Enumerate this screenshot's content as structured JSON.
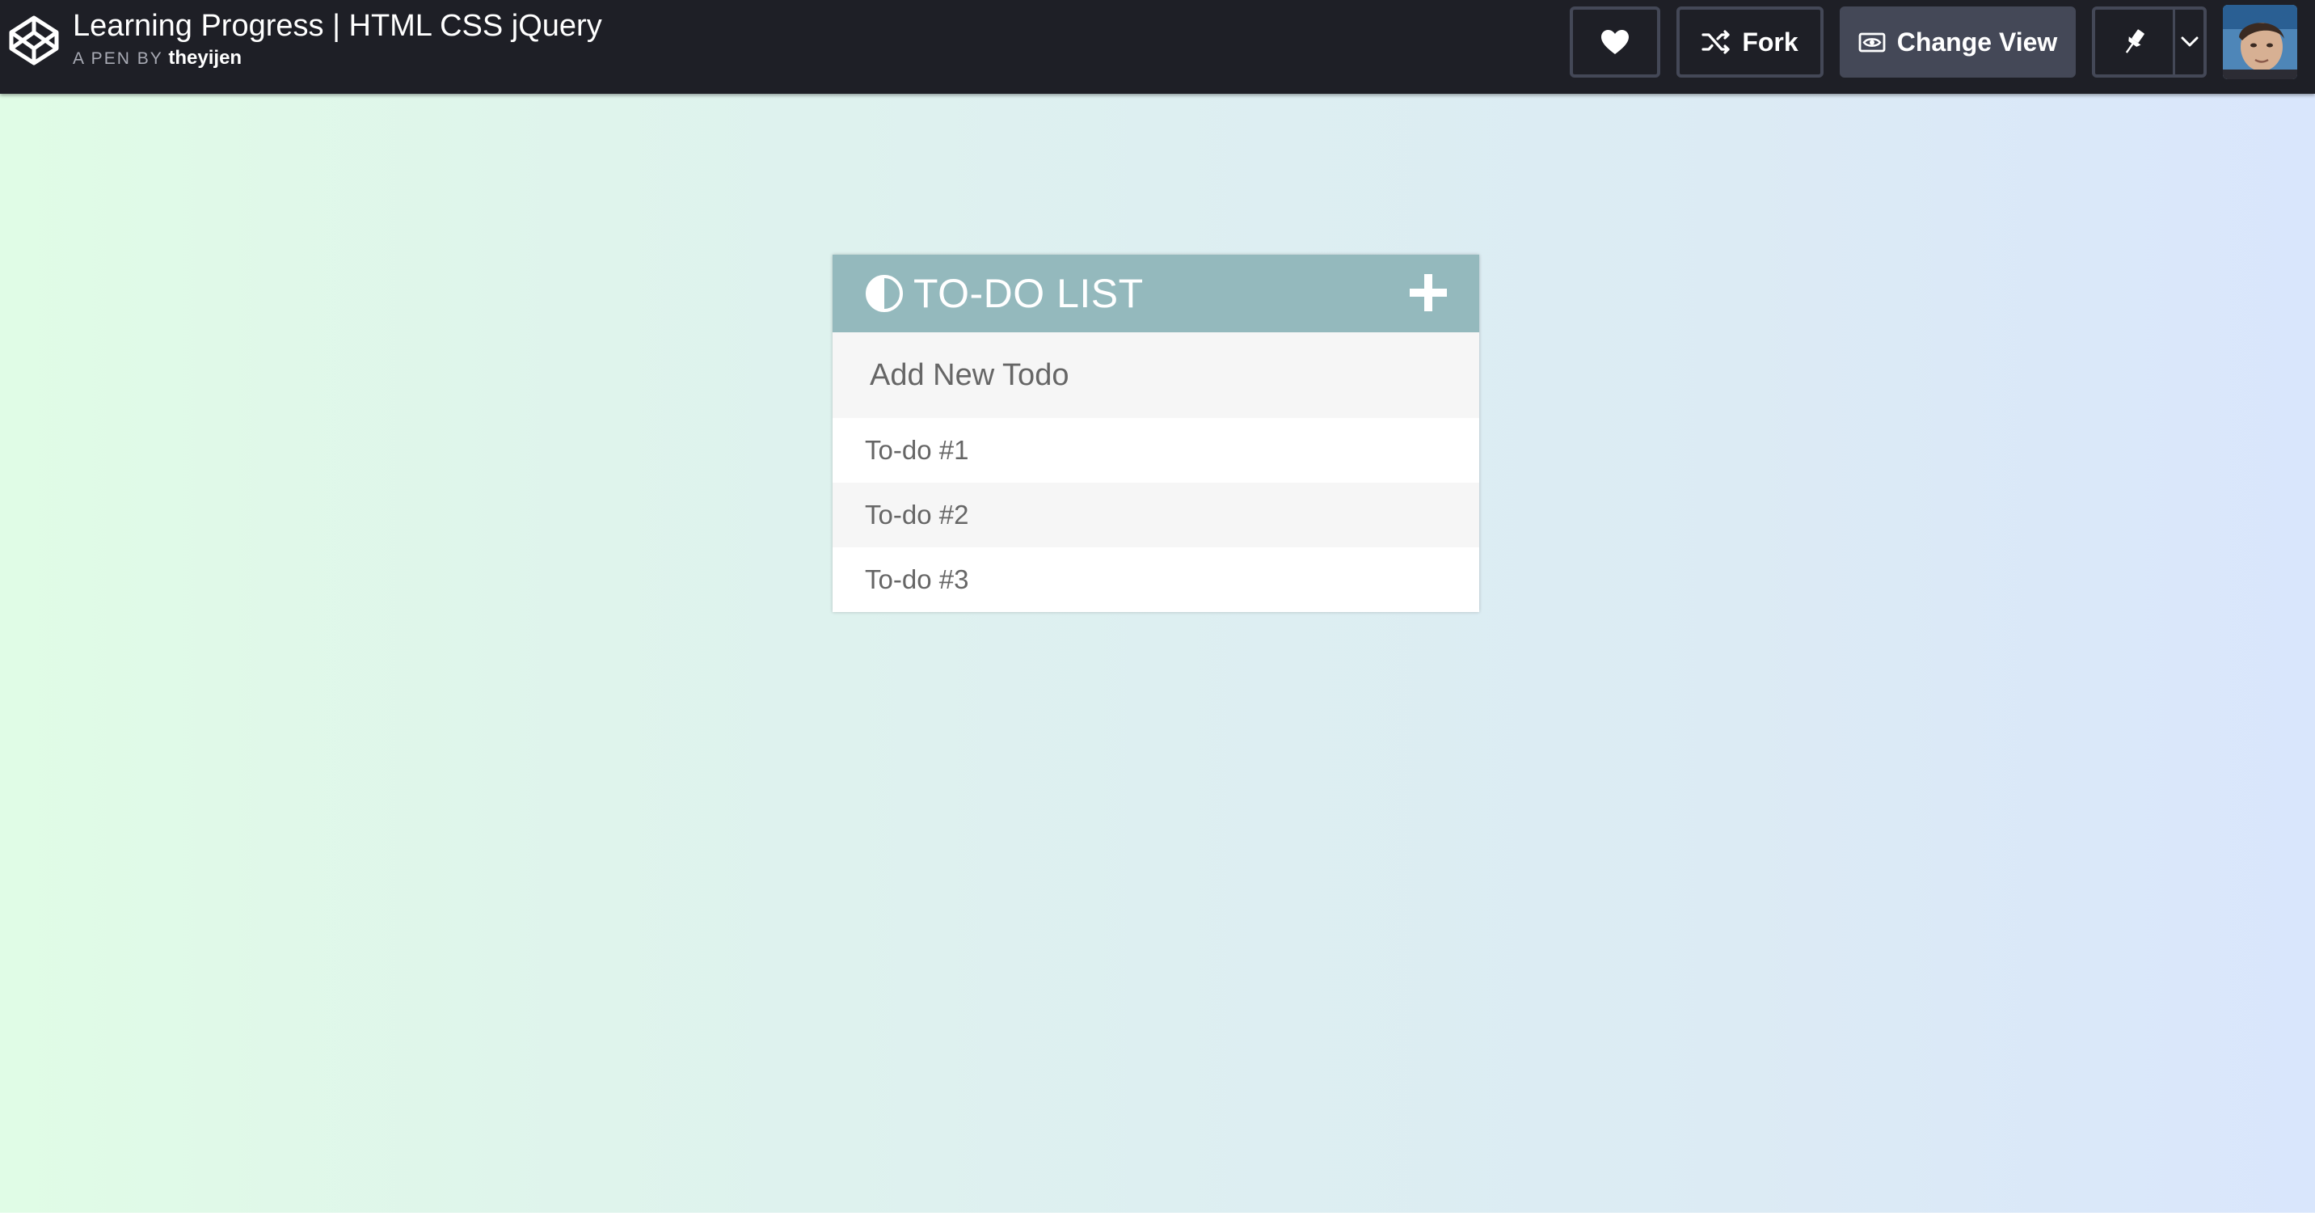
{
  "header": {
    "title": "Learning Progress | HTML CSS jQuery",
    "by_label": "A PEN BY",
    "author": "theyijen",
    "logo_icon": "codepen-logo-icon",
    "buttons": {
      "heart_icon": "heart-icon",
      "fork_label": "Fork",
      "fork_icon": "fork-icon",
      "view_label": "Change View",
      "view_icon": "eye-icon",
      "pin_icon": "pin-icon",
      "dropdown_icon": "chevron-down-icon"
    },
    "avatar": "user-avatar"
  },
  "todo": {
    "title": "TO-DO LIST",
    "title_icon": "half-circle-icon",
    "add_icon": "plus-icon",
    "input_placeholder": "Add New Todo",
    "items": [
      {
        "label": "To-do #1"
      },
      {
        "label": "To-do #2"
      },
      {
        "label": "To-do #3"
      }
    ]
  },
  "colors": {
    "topbar_bg": "#1e1f26",
    "button_border": "#444857",
    "todo_header_bg": "#94b9bd",
    "todo_text": "#666666",
    "gradient_left": "#e0fce6",
    "gradient_right": "#d9e6fc"
  }
}
